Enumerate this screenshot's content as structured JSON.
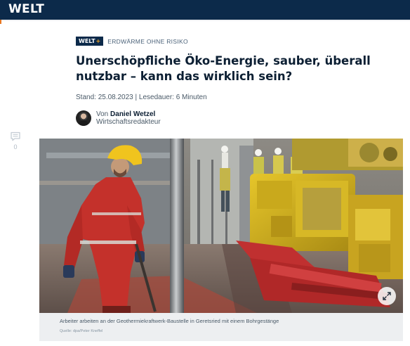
{
  "header": {
    "logo_text": "WELT"
  },
  "article": {
    "badge": {
      "brand": "WELT",
      "plus": "+"
    },
    "kicker": "ERDWÄRME OHNE RISIKO",
    "headline": "Unerschöpfliche Öko-Energie, sauber, überall nutzbar – kann das wirklich sein?",
    "meta": "Stand: 25.08.2023 | Lesedauer: 6 Minuten",
    "author": {
      "by_label": "Von",
      "name": "Daniel Wetzel",
      "role": "Wirtschaftsredakteur"
    },
    "comments": {
      "count": "0"
    },
    "figure": {
      "caption": "Arbeiter arbeiten an der Geothermiekraftwerk-Baustelle in Geretsried mit einem Bohrgestänge",
      "credit": "Quelle: dpa/Peter Kneffel"
    }
  },
  "colors": {
    "brand_navy": "#0c2a4a",
    "plus_accent": "#f5a623",
    "text_dark": "#0c1f33",
    "text_muted": "#4a5a68"
  },
  "icons": [
    "comment-icon",
    "expand-icon",
    "avatar"
  ]
}
